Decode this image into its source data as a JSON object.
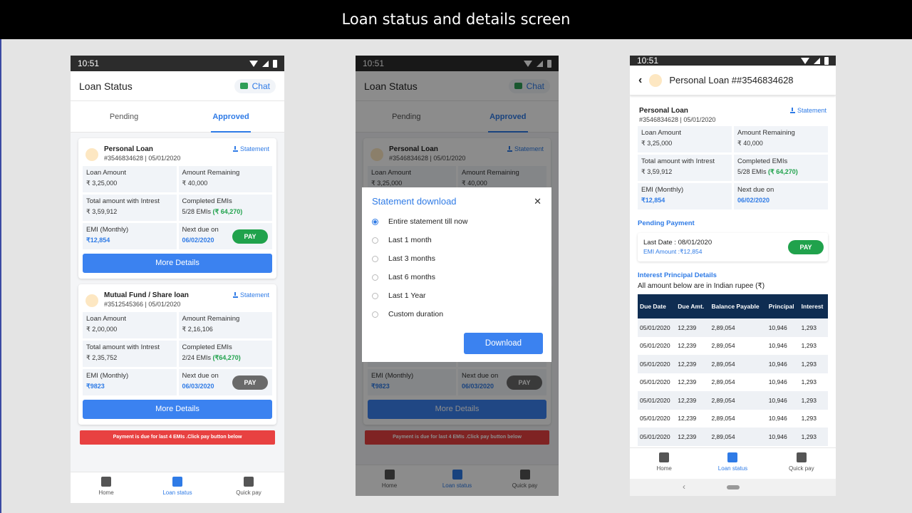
{
  "page_title": "Loan status and details screen",
  "status_time": "10:51",
  "app": {
    "title": "Loan Status",
    "chat": "Chat",
    "tabs": [
      "Pending",
      "Approved"
    ]
  },
  "loans": [
    {
      "name": "Personal Loan",
      "id": "#3546834628 | 05/01/2020",
      "statement": "Statement",
      "cells": [
        [
          "Loan Amount",
          "₹ 3,25,000"
        ],
        [
          "Amount Remaining",
          "₹ 40,000"
        ],
        [
          "Total amount with Intrest",
          "₹ 3,59,912"
        ],
        [
          "Completed EMIs",
          "5/28 EMIs",
          "(₹ 64,270)"
        ],
        [
          "EMI (Monthly)",
          "₹12,854"
        ],
        [
          "Next due on",
          "06/02/2020"
        ]
      ],
      "pay": "PAY",
      "more": "More Details"
    },
    {
      "name": "Mutual Fund / Share loan",
      "id": "#3512545366 | 05/01/2020",
      "statement": "Statement",
      "cells": [
        [
          "Loan Amount",
          "₹ 2,00,000"
        ],
        [
          "Amount Remaining",
          "₹ 2,16,106"
        ],
        [
          "Total amount with Intrest",
          "₹ 2,35,752"
        ],
        [
          "Completed EMIs",
          "2/24 EMIs",
          "(₹64,270)"
        ],
        [
          "EMI (Monthly)",
          "₹9823"
        ],
        [
          "Next due on",
          "06/03/2020"
        ]
      ],
      "pay": "PAY",
      "more": "More Details"
    }
  ],
  "alert": "Payment is due for last 4 EMIs .Click pay button below",
  "nav": [
    "Home",
    "Loan status",
    "Quick pay"
  ],
  "modal": {
    "title": "Statement download",
    "close": "✕",
    "options": [
      "Entire statement till now",
      "Last 1 month",
      "Last 3 months",
      "Last 6 months",
      "Last 1 Year",
      "Custom duration"
    ],
    "button": "Download"
  },
  "detail": {
    "title": "Personal Loan ##3546834628",
    "loan_name": "Personal Loan",
    "loan_id": "#3546834628 | 05/01/2020",
    "statement": "Statement",
    "cells": [
      [
        "Loan Amount",
        "₹ 3,25,000"
      ],
      [
        "Amount Remaining",
        "₹ 40,000"
      ],
      [
        "Total amount with Intrest",
        "₹ 3,59,912"
      ],
      [
        "Completed EMIs",
        "5/28 EMIs",
        "(₹ 64,270)"
      ],
      [
        "EMI (Monthly)",
        "₹12,854"
      ],
      [
        "Next due on",
        "06/02/2020"
      ]
    ],
    "pending_title": "Pending Payment",
    "last_date": "Last Date : 08/01/2020",
    "emi_amount": "EMI Amount :₹12,854",
    "pay": "PAY",
    "interest_title": "Interest Principal Details",
    "interest_note": "All amount below are in Indian rupee (₹)",
    "headers": [
      "Due Date",
      "Due Amt.",
      "Balance Payable",
      "Principal",
      "Interest"
    ],
    "rows": [
      [
        "05/01/2020",
        "12,239",
        "2,89,054",
        "10,946",
        "1,293"
      ],
      [
        "05/01/2020",
        "12,239",
        "2,89,054",
        "10,946",
        "1,293"
      ],
      [
        "05/01/2020",
        "12,239",
        "2,89,054",
        "10,946",
        "1,293"
      ],
      [
        "05/01/2020",
        "12,239",
        "2,89,054",
        "10,946",
        "1,293"
      ],
      [
        "05/01/2020",
        "12,239",
        "2,89,054",
        "10,946",
        "1,293"
      ],
      [
        "05/01/2020",
        "12,239",
        "2,89,054",
        "10,946",
        "1,293"
      ],
      [
        "05/01/2020",
        "12,239",
        "2,89,054",
        "10,946",
        "1,293"
      ]
    ]
  }
}
